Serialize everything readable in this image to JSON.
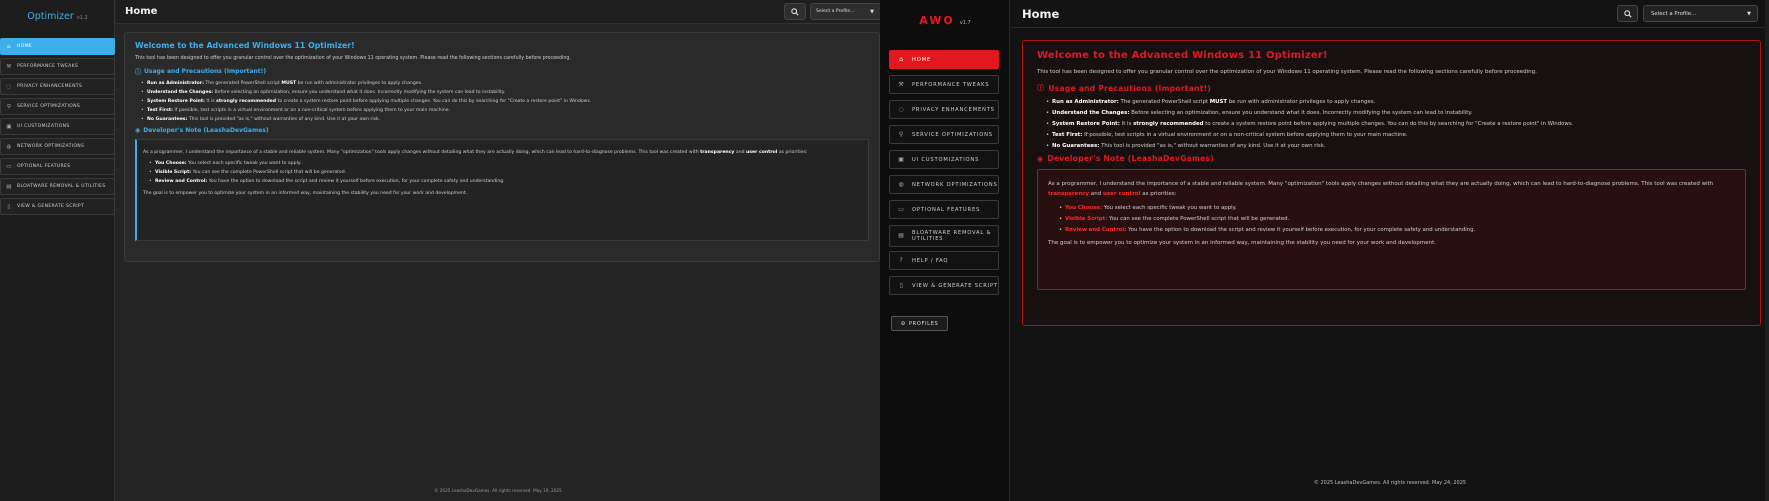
{
  "left": {
    "brand": {
      "name": "Optimizer",
      "version": "v1.2"
    },
    "page_title": "Home",
    "select_placeholder": "Select a Profile...",
    "nav": [
      {
        "label": "HOME",
        "icon": "home-icon",
        "active": true
      },
      {
        "label": "PERFORMANCE TWEAKS",
        "icon": "tools-icon"
      },
      {
        "label": "PRIVACY ENHANCEMENTS",
        "icon": "shield-icon"
      },
      {
        "label": "SERVICE OPTIMIZATIONS",
        "icon": "wrench-icon"
      },
      {
        "label": "UI CUSTOMIZATIONS",
        "icon": "palette-icon"
      },
      {
        "label": "NETWORK OPTIMIZATIONS",
        "icon": "globe-icon"
      },
      {
        "label": "OPTIONAL FEATURES",
        "icon": "laptop-icon"
      },
      {
        "label": "BLOATWARE REMOVAL & UTILITIES",
        "icon": "trash-icon"
      },
      {
        "label": "VIEW & GENERATE SCRIPT",
        "icon": "file-icon"
      }
    ],
    "footer": "© 2025 LeashaDevGames. All rights reserved. May 19, 2025"
  },
  "right": {
    "brand": {
      "name": "AWO",
      "version": "v1.7"
    },
    "page_title": "Home",
    "select_placeholder": "Select a Profile...",
    "nav": [
      {
        "label": "HOME",
        "icon": "home-icon",
        "active": true
      },
      {
        "label": "PERFORMANCE TWEAKS",
        "icon": "tools-icon"
      },
      {
        "label": "PRIVACY ENHANCEMENTS",
        "icon": "shield-icon"
      },
      {
        "label": "SERVICE OPTIMIZATIONS",
        "icon": "wrench-icon"
      },
      {
        "label": "UI CUSTOMIZATIONS",
        "icon": "palette-icon"
      },
      {
        "label": "NETWORK OPTIMIZATIONS",
        "icon": "globe-icon"
      },
      {
        "label": "OPTIONAL FEATURES",
        "icon": "laptop-icon"
      },
      {
        "label": "BLOATWARE REMOVAL & UTILITIES",
        "icon": "trash-icon"
      },
      {
        "label": "HELP / FAQ",
        "icon": "help-icon"
      },
      {
        "label": "VIEW & GENERATE SCRIPT",
        "icon": "file-icon"
      }
    ],
    "profiles_label": "PROFILES",
    "footer": "© 2025 LeashaDevGames. All rights reserved. May 24, 2025"
  },
  "content": {
    "welcome_title": "Welcome to the Advanced Windows 11 Optimizer!",
    "intro": "This tool has been designed to offer you granular control over the optimization of your Windows 11 operating system. Please read the following sections carefully before proceeding.",
    "usage_title": "Usage and Precautions (Important!)",
    "usage": [
      {
        "label": "Run as Administrator:",
        "pre": "The generated PowerShell script",
        "bold": "MUST",
        "post": "be run with administrator privileges to apply changes."
      },
      {
        "label": "Understand the Changes:",
        "pre": "Before selecting an optimization, ensure you understand what it does. Incorrectly modifying the system can lead to instability.",
        "bold": "",
        "post": ""
      },
      {
        "label": "System Restore Point:",
        "pre": "It is",
        "bold": "strongly recommended",
        "post": "to create a system restore point before applying multiple changes. You can do this by searching for \"Create a restore point\" in Windows."
      },
      {
        "label": "Test First:",
        "pre": "If possible, test scripts in a virtual environment or on a non-critical system before applying them to your main machine.",
        "bold": "",
        "post": ""
      },
      {
        "label": "No Guarantees:",
        "pre": "This tool is provided \"as is,\" without warranties of any kind. Use it at your own risk.",
        "bold": "",
        "post": ""
      }
    ],
    "dev_title": "Developer's Note (LeashaDevGames)",
    "dev_intro_pre": "As a programmer, I understand the importance of a stable and reliable system. Many \"optimization\" tools apply changes without detailing what they are actually doing, which can lead to hard-to-diagnose problems. This tool was created with",
    "dev_transparency": "transparency",
    "dev_and": "and",
    "dev_user_control": "user control",
    "dev_intro_post": "as priorities:",
    "dev_points": [
      {
        "label": "You Choose:",
        "text": "You select each specific tweak you want to apply."
      },
      {
        "label": "Visible Script:",
        "text": "You can see the complete PowerShell script that will be generated."
      },
      {
        "label": "Review and Control:",
        "text": "You have the option to download the script and review it yourself before execution, for your complete safety and understanding."
      }
    ],
    "dev_goal": "The goal is to empower you to optimize your system in an informed way, maintaining the stability you need for your work and development."
  },
  "colors": {
    "left_accent": "#3daee9",
    "right_accent": "#e3171f"
  }
}
